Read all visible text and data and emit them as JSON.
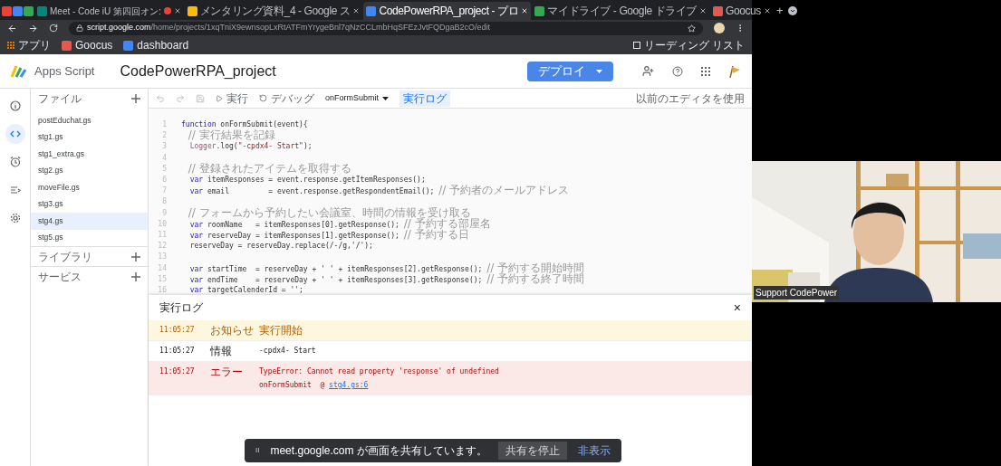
{
  "browser": {
    "tabs": [
      {
        "kind": "pinned",
        "color": "#ea4335",
        "selected": false
      },
      {
        "kind": "pinned",
        "color": "#4285f4",
        "selected": false
      },
      {
        "kind": "pinned",
        "color": "#34a853",
        "selected": false
      },
      {
        "kind": "page",
        "label": "Meet - Code iU 第四回オン:",
        "color": "#00897b",
        "recording": true,
        "selected": false
      },
      {
        "kind": "page",
        "label": "メンタリング資料_4 - Google ス",
        "color": "#fbbc04",
        "recording": false,
        "selected": false
      },
      {
        "kind": "page",
        "label": "CodePowerRPA_project - プロ",
        "color": "#4285f4",
        "recording": false,
        "selected": true
      },
      {
        "kind": "page",
        "label": "マイドライブ - Google ドライブ",
        "color": "#34a853",
        "recording": false,
        "selected": false
      },
      {
        "kind": "page",
        "label": "Goocus",
        "color": "#e05a4f",
        "recording": false,
        "selected": false
      }
    ],
    "new_tab": "+",
    "url_host": "script.google.com",
    "url_path": "/home/projects/1xqTniX9ewnsopLxRtATFmYrygeBnl7qNzCCLmbHqSFEzJvtFQDgaB2cO/edit",
    "bookmarks": [
      {
        "label": "アプリ",
        "kind": "apps"
      },
      {
        "label": "Goocus",
        "kind": "goocus"
      },
      {
        "label": "dashboard",
        "kind": "script"
      }
    ],
    "reading_list": "リーディング リスト"
  },
  "app": {
    "product": "Apps Script",
    "project": "CodePowerRPA_project",
    "deploy": "デプロイ",
    "rail": [
      {
        "kind": "info",
        "selected": false
      },
      {
        "kind": "code",
        "selected": true
      },
      {
        "kind": "clock",
        "selected": false
      },
      {
        "kind": "run",
        "selected": false
      },
      {
        "kind": "gear",
        "selected": false
      }
    ],
    "files_header": "ファイル",
    "files": [
      {
        "name": "postEduchat.gs",
        "selected": false
      },
      {
        "name": "stg1.gs",
        "selected": false
      },
      {
        "name": "stg1_extra.gs",
        "selected": false
      },
      {
        "name": "stg2.gs",
        "selected": false
      },
      {
        "name": "moveFile.gs",
        "selected": false
      },
      {
        "name": "stg3.gs",
        "selected": false
      },
      {
        "name": "stg4.gs",
        "selected": true
      },
      {
        "name": "stg5.gs",
        "selected": false
      }
    ],
    "sections": [
      "ライブラリ",
      "サービス"
    ],
    "toolbar": {
      "run": "実行",
      "debug": "デバッグ",
      "function": "onFormSubmit",
      "log": {
        "label": "実行ログ",
        "selected": true
      },
      "legacy": "以前のエディタを使用"
    },
    "code": [
      {
        "number": "1",
        "tokens": [
          {
            "kind": "kw",
            "text": "function"
          },
          {
            "kind": "plain",
            "text": " onFormSubmit(event){"
          }
        ]
      },
      {
        "number": "2",
        "tokens": [
          {
            "kind": "comment",
            "text": "  // 実行結果を記録"
          }
        ]
      },
      {
        "number": "3",
        "tokens": [
          {
            "kind": "cls",
            "text": "  Logger"
          },
          {
            "kind": "plain",
            "text": ".log("
          },
          {
            "kind": "str",
            "text": "\"-cpdx4- Start\""
          },
          {
            "kind": "plain",
            "text": ");"
          }
        ]
      },
      {
        "number": "4"
      },
      {
        "number": "5",
        "tokens": [
          {
            "kind": "comment",
            "text": "  // 登録されたアイテムを取得する"
          }
        ]
      },
      {
        "number": "6",
        "tokens": [
          {
            "kind": "kw",
            "text": "  var"
          },
          {
            "kind": "plain",
            "text": " itemResponses = event.response.getItemResponses();"
          }
        ]
      },
      {
        "number": "7",
        "tokens": [
          {
            "kind": "kw",
            "text": "  var"
          },
          {
            "kind": "plain",
            "text": " email         = event.response.getRespondentEmail(); "
          },
          {
            "kind": "comment",
            "text": "// 予約者のメールアドレス"
          }
        ]
      },
      {
        "number": "8"
      },
      {
        "number": "9",
        "tokens": [
          {
            "kind": "comment",
            "text": "  // フォームから予約したい会議室、時間の情報を受け取る"
          }
        ]
      },
      {
        "number": "10",
        "tokens": [
          {
            "kind": "kw",
            "text": "  var"
          },
          {
            "kind": "plain",
            "text": " roomName   = itemResponses[0].getResponse(); "
          },
          {
            "kind": "comment",
            "text": "// 予約する部屋名"
          }
        ]
      },
      {
        "number": "11",
        "tokens": [
          {
            "kind": "kw",
            "text": "  var"
          },
          {
            "kind": "plain",
            "text": " reserveDay = itemResponses[1].getResponse(); "
          },
          {
            "kind": "comment",
            "text": "// 予約する日"
          }
        ]
      },
      {
        "number": "12",
        "tokens": [
          {
            "kind": "plain",
            "text": "  reserveDay = reserveDay.replace(/-/g,'/');"
          }
        ]
      },
      {
        "number": "13"
      },
      {
        "number": "14",
        "tokens": [
          {
            "kind": "kw",
            "text": "  var"
          },
          {
            "kind": "plain",
            "text": " startTime  = reserveDay + ' ' + itemResponses[2].getResponse(); "
          },
          {
            "kind": "comment",
            "text": "// 予約する開始時間"
          }
        ]
      },
      {
        "number": "15",
        "tokens": [
          {
            "kind": "kw",
            "text": "  var"
          },
          {
            "kind": "plain",
            "text": " endTime    = reserveDay + ' ' + itemResponses[3].getResponse(); "
          },
          {
            "kind": "comment",
            "text": "// 予約する終了時間"
          }
        ]
      },
      {
        "number": "16",
        "tokens": [
          {
            "kind": "kw",
            "text": "  var"
          },
          {
            "kind": "plain",
            "text": " targetCalenderId = '';"
          }
        ]
      }
    ],
    "log": {
      "title": "実行ログ",
      "close": "×",
      "rows": [
        {
          "kind": "notice",
          "time": "11:05:27",
          "level": "お知らせ",
          "message": "実行開始"
        },
        {
          "kind": "info",
          "time": "11:05:27",
          "level": "情報",
          "message": "-cpdx4- Start"
        },
        {
          "kind": "error",
          "time": "11:05:27",
          "level": "エラー",
          "message": "TypeError: Cannot read property 'response' of undefined",
          "trace": "onFormSubmit  @ ",
          "link": "stg4.gs:6"
        }
      ]
    }
  },
  "share_bar": {
    "handle": "II",
    "message": "meet.google.com が画面を共有しています。",
    "stop": "共有を停止",
    "hide": "非表示"
  },
  "video": {
    "name": "Support CodePower"
  }
}
